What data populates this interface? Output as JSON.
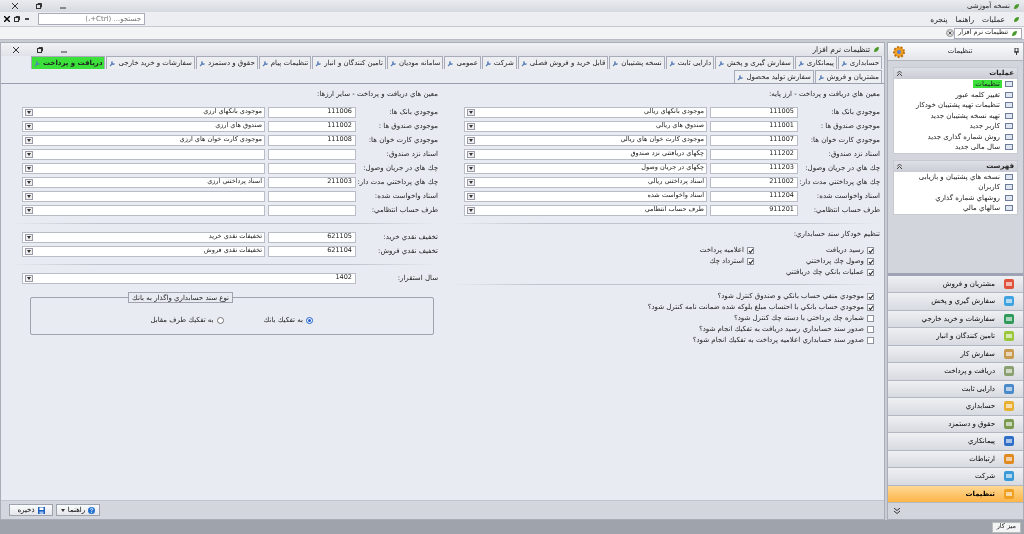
{
  "app_title": "نسخه آموزشی",
  "menu": [
    "عملیات",
    "راهنما",
    "پنجره"
  ],
  "search": {
    "placeholder": "جستجو... (Ctrl+،)"
  },
  "document_tabs": [
    {
      "label": "تنظیمات نرم افزار",
      "selected": true
    }
  ],
  "window": {
    "title": "تنظیمات نرم افزار"
  },
  "tabs": [
    {
      "label": "حسابداری",
      "selected": false
    },
    {
      "label": "پیمانکاری",
      "selected": false
    },
    {
      "label": "سفارش گیری و پخش",
      "selected": false
    },
    {
      "label": "دارایی ثابت",
      "selected": false
    },
    {
      "label": "نسخه پشتیبان",
      "selected": false
    },
    {
      "label": "قابل خرید و فروش فصلی",
      "selected": false
    },
    {
      "label": "شرکت",
      "selected": false
    },
    {
      "label": "عمومی",
      "selected": false
    },
    {
      "label": "سامانه مودیان",
      "selected": false
    },
    {
      "label": "تامین کنندگان و انبار",
      "selected": false
    },
    {
      "label": "تنظیمات پیام",
      "selected": false
    },
    {
      "label": "حقوق و دستمزد",
      "selected": false
    },
    {
      "label": "سفارشات و خرید خارجی",
      "selected": false
    },
    {
      "label": "دریافت و پرداخت",
      "selected": true
    },
    {
      "label": "مشتریان و فروش",
      "selected": false
    },
    {
      "label": "سفارش تولید محصول",
      "selected": false
    }
  ],
  "base_currency": {
    "heading": "معین هاي دریافت و پرداخت - ارز پایه:",
    "rows": [
      {
        "label": "موجودي بانک ها:",
        "code": "111005",
        "account": "موجودي بانکهاي ريالي"
      },
      {
        "label": "موجودي صندوق ها :",
        "code": "111001",
        "account": "صندوق هاي ريالي"
      },
      {
        "label": "موجودي کارت خوان ها:",
        "code": "111007",
        "account": "موجودي کارت خوان هاي ريالي"
      },
      {
        "label": "اسناد نزد صندوق:",
        "code": "111202",
        "account": "چکهاي دريافتني نزد صندوق"
      },
      {
        "label": "چك هاي در جريان وصول:",
        "code": "111203",
        "account": "چکهاي در جريان وصول"
      },
      {
        "label": "چك هاي پرداختني مدت دار:",
        "code": "211002",
        "account": "اسناد پرداختني ريالي"
      },
      {
        "label": "اسناد واخواست شده:",
        "code": "111204",
        "account": "اسناد واخواست شده"
      },
      {
        "label": "طرف حساب انتظامي:",
        "code": "911201",
        "account": "طرف حساب انتظامي"
      }
    ]
  },
  "auto_voucher": {
    "heading": "تنظیم خودکار سند حسابداري:",
    "checkboxes": [
      {
        "label": "رسید دریافت",
        "checked": true
      },
      {
        "label": "اعلامیه پرداخت",
        "checked": true
      },
      {
        "label": "وصول چك پرداختني",
        "checked": true
      },
      {
        "label": "استرداد چك",
        "checked": true
      },
      {
        "label": "عملیات بانکي چك دریافتني",
        "checked": true
      }
    ]
  },
  "controls": [
    {
      "label": "موجودي منفي حساب بانکي و صندوق  کنترل شود؟",
      "checked": true
    },
    {
      "label": "موجودي حساب بانکي با احتساب مبلغ بلوکه شده ضمانت نامه کنترل شود؟",
      "checked": true
    },
    {
      "label": "شماره چك پرداختي با دسته چك کنترل شود؟",
      "checked": false
    },
    {
      "label": "صدور سند حسابداري رسید دریافت به تفکیك انجام شود؟",
      "checked": false
    },
    {
      "label": "صدور سند حسابداري اعلامیه پرداخت به تفکیك انجام شود؟",
      "checked": false
    }
  ],
  "other_currencies": {
    "heading": "معین هاي دریافت و پرداخت - ساير ارزها:",
    "rows": [
      {
        "label": "موجودي بانک ها:",
        "code": "111006",
        "account": "موجودي بانکهاي ارزي"
      },
      {
        "label": "موجودي صندوق ها :",
        "code": "111002",
        "account": "صندوق هاي ارزي"
      },
      {
        "label": "موجودي کارت خوان ها:",
        "code": "111008",
        "account": "موجودي کارت خوان هاي ارزي"
      },
      {
        "label": "اسناد نزد صندوق:"
      },
      {
        "label": "چك هاي در جريان وصول:"
      },
      {
        "label": "چك هاي پرداختني مدت دار:",
        "code": "211003",
        "account": "اسناد پرداختني ارزي"
      },
      {
        "label": "اسناد واخواست شده:"
      },
      {
        "label": "طرف حساب انتظامي:"
      }
    ]
  },
  "discounts": [
    {
      "label": "تخفيف نقدي خريد:",
      "code": "621105",
      "account": "تخفيفات نقدي خريد"
    },
    {
      "label": "تخفيف نقدي فروش:",
      "code": "621104",
      "account": "تخفيفات نقدي فروش"
    }
  ],
  "year": {
    "label": "سال استقرار:",
    "value": "1402"
  },
  "bank_voucher": {
    "title": "نوع سند حسابداري واگذار به بانك",
    "options": [
      {
        "label": "به تفکیك بانك",
        "selected": true
      },
      {
        "label": "به تفکیك طرف مقابل",
        "selected": false
      }
    ]
  },
  "buttons": [
    {
      "label": "راهنما",
      "kind": "help"
    },
    {
      "label": "ذخیره",
      "kind": "save"
    }
  ],
  "sidebar": {
    "title": "تنظیمات",
    "groups": [
      {
        "title": "عملیات",
        "items": [
          {
            "label": "تنظیمات",
            "selected": true
          },
          {
            "label": "تغییر کلمه عبور",
            "selected": false
          },
          {
            "label": "تنظیمات تهیه پشتیبان خودکار",
            "selected": false
          },
          {
            "label": "تهیه نسخه پشتیبان جدید",
            "selected": false
          },
          {
            "label": "کاربر جدید",
            "selected": false
          },
          {
            "label": "روش شماره گذاری جدید",
            "selected": false
          },
          {
            "label": "سال مالی جدید",
            "selected": false
          }
        ]
      },
      {
        "title": "فهرست",
        "items": [
          {
            "label": "نسخه هاي پشتیبان و بازیابی",
            "selected": false
          },
          {
            "label": "کاربران",
            "selected": false
          },
          {
            "label": "روشهاي شماره گذاري",
            "selected": false
          },
          {
            "label": "سالهاي مالي",
            "selected": false
          }
        ]
      }
    ],
    "nav": [
      {
        "label": "مشتریان و فروش",
        "selected": false
      },
      {
        "label": "سفارش گیري و پخش",
        "selected": false
      },
      {
        "label": "سفارشات و خريد خارجي",
        "selected": false
      },
      {
        "label": "تامين كنندگان و انبار",
        "selected": false
      },
      {
        "label": "سفارش کار",
        "selected": false
      },
      {
        "label": "دریافت و پرداخت",
        "selected": false
      },
      {
        "label": "دارایی ثابت",
        "selected": false
      },
      {
        "label": "حسابداري",
        "selected": false
      },
      {
        "label": "حقوق و دستمزد",
        "selected": false
      },
      {
        "label": "پیمانکاري",
        "selected": false
      },
      {
        "label": "ارتباطات",
        "selected": false
      },
      {
        "label": "شرکت",
        "selected": false
      },
      {
        "label": "تنظیمات",
        "selected": true
      }
    ]
  },
  "status_bar": {
    "tabs": [
      "میز کار"
    ]
  }
}
